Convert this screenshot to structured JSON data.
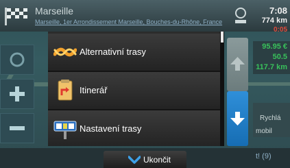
{
  "header": {
    "city": "Marseille",
    "address": "Marseille, 1er Arrondissement Marseille, Bouches-du-Rhône, France",
    "time": "7:08",
    "distance": "774 km",
    "small_value": "0:05"
  },
  "right_panel": {
    "values": [
      "95.95 €",
      "50.5",
      "117.7 km"
    ],
    "label_a": "Rychlá",
    "label_b": "mobil"
  },
  "menu": {
    "items": [
      {
        "label": "Alternativní trasy",
        "icon": "alternative-routes-icon"
      },
      {
        "label": "Itinerář",
        "icon": "itinerary-icon"
      },
      {
        "label": "Nastavení trasy",
        "icon": "route-settings-icon"
      }
    ],
    "close_label": "Ukončit"
  },
  "bottom": {
    "right_text": "t! (9)"
  },
  "colors": {
    "accent_blue": "#1e7fcc",
    "green_value": "#38c25b",
    "red_value": "#e04b3c",
    "menu_bg": "#2c2c2c"
  }
}
